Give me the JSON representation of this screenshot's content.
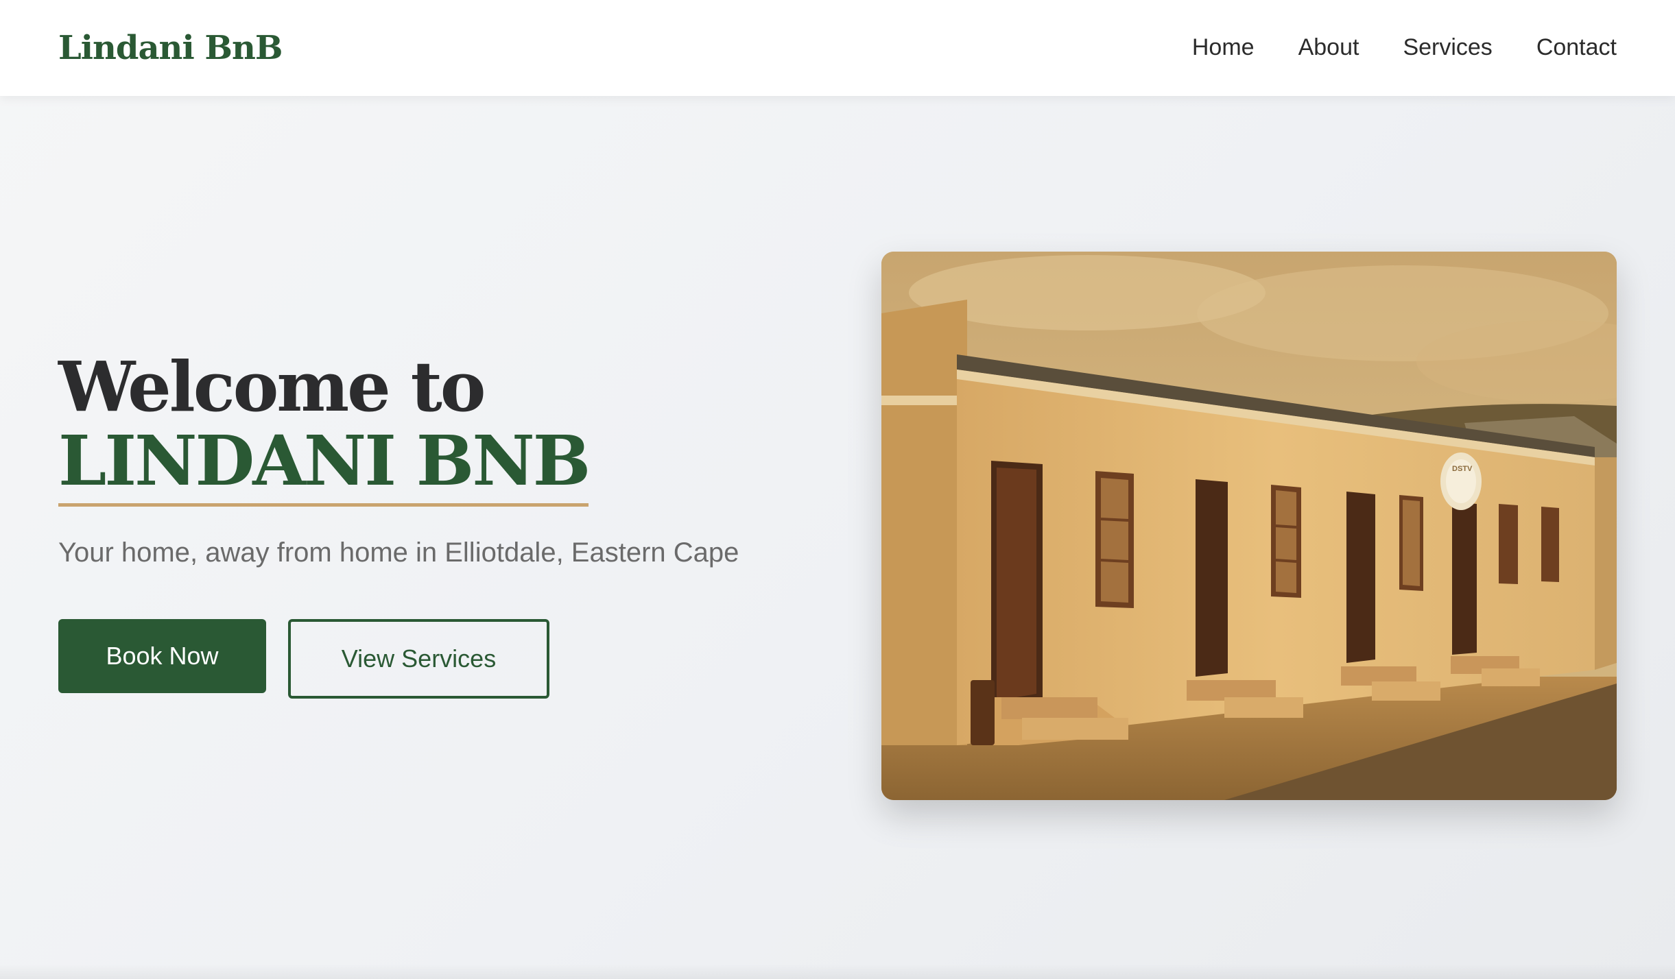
{
  "colors": {
    "brand_green": "#2a5934",
    "accent_gold": "#c9a36e",
    "text_dark": "#2c2c2e",
    "text_muted": "#6a6a6a"
  },
  "navbar": {
    "brand": "Lindani BnB",
    "links": [
      "Home",
      "About",
      "Services",
      "Contact"
    ]
  },
  "hero": {
    "title_line1": "Welcome to",
    "title_line2": "LINDANI BNB",
    "subtitle": "Your home, away from home in Elliotdale, Eastern Cape",
    "primary_button": "Book Now",
    "secondary_button": "View Services",
    "image_sign": "DSTV"
  }
}
